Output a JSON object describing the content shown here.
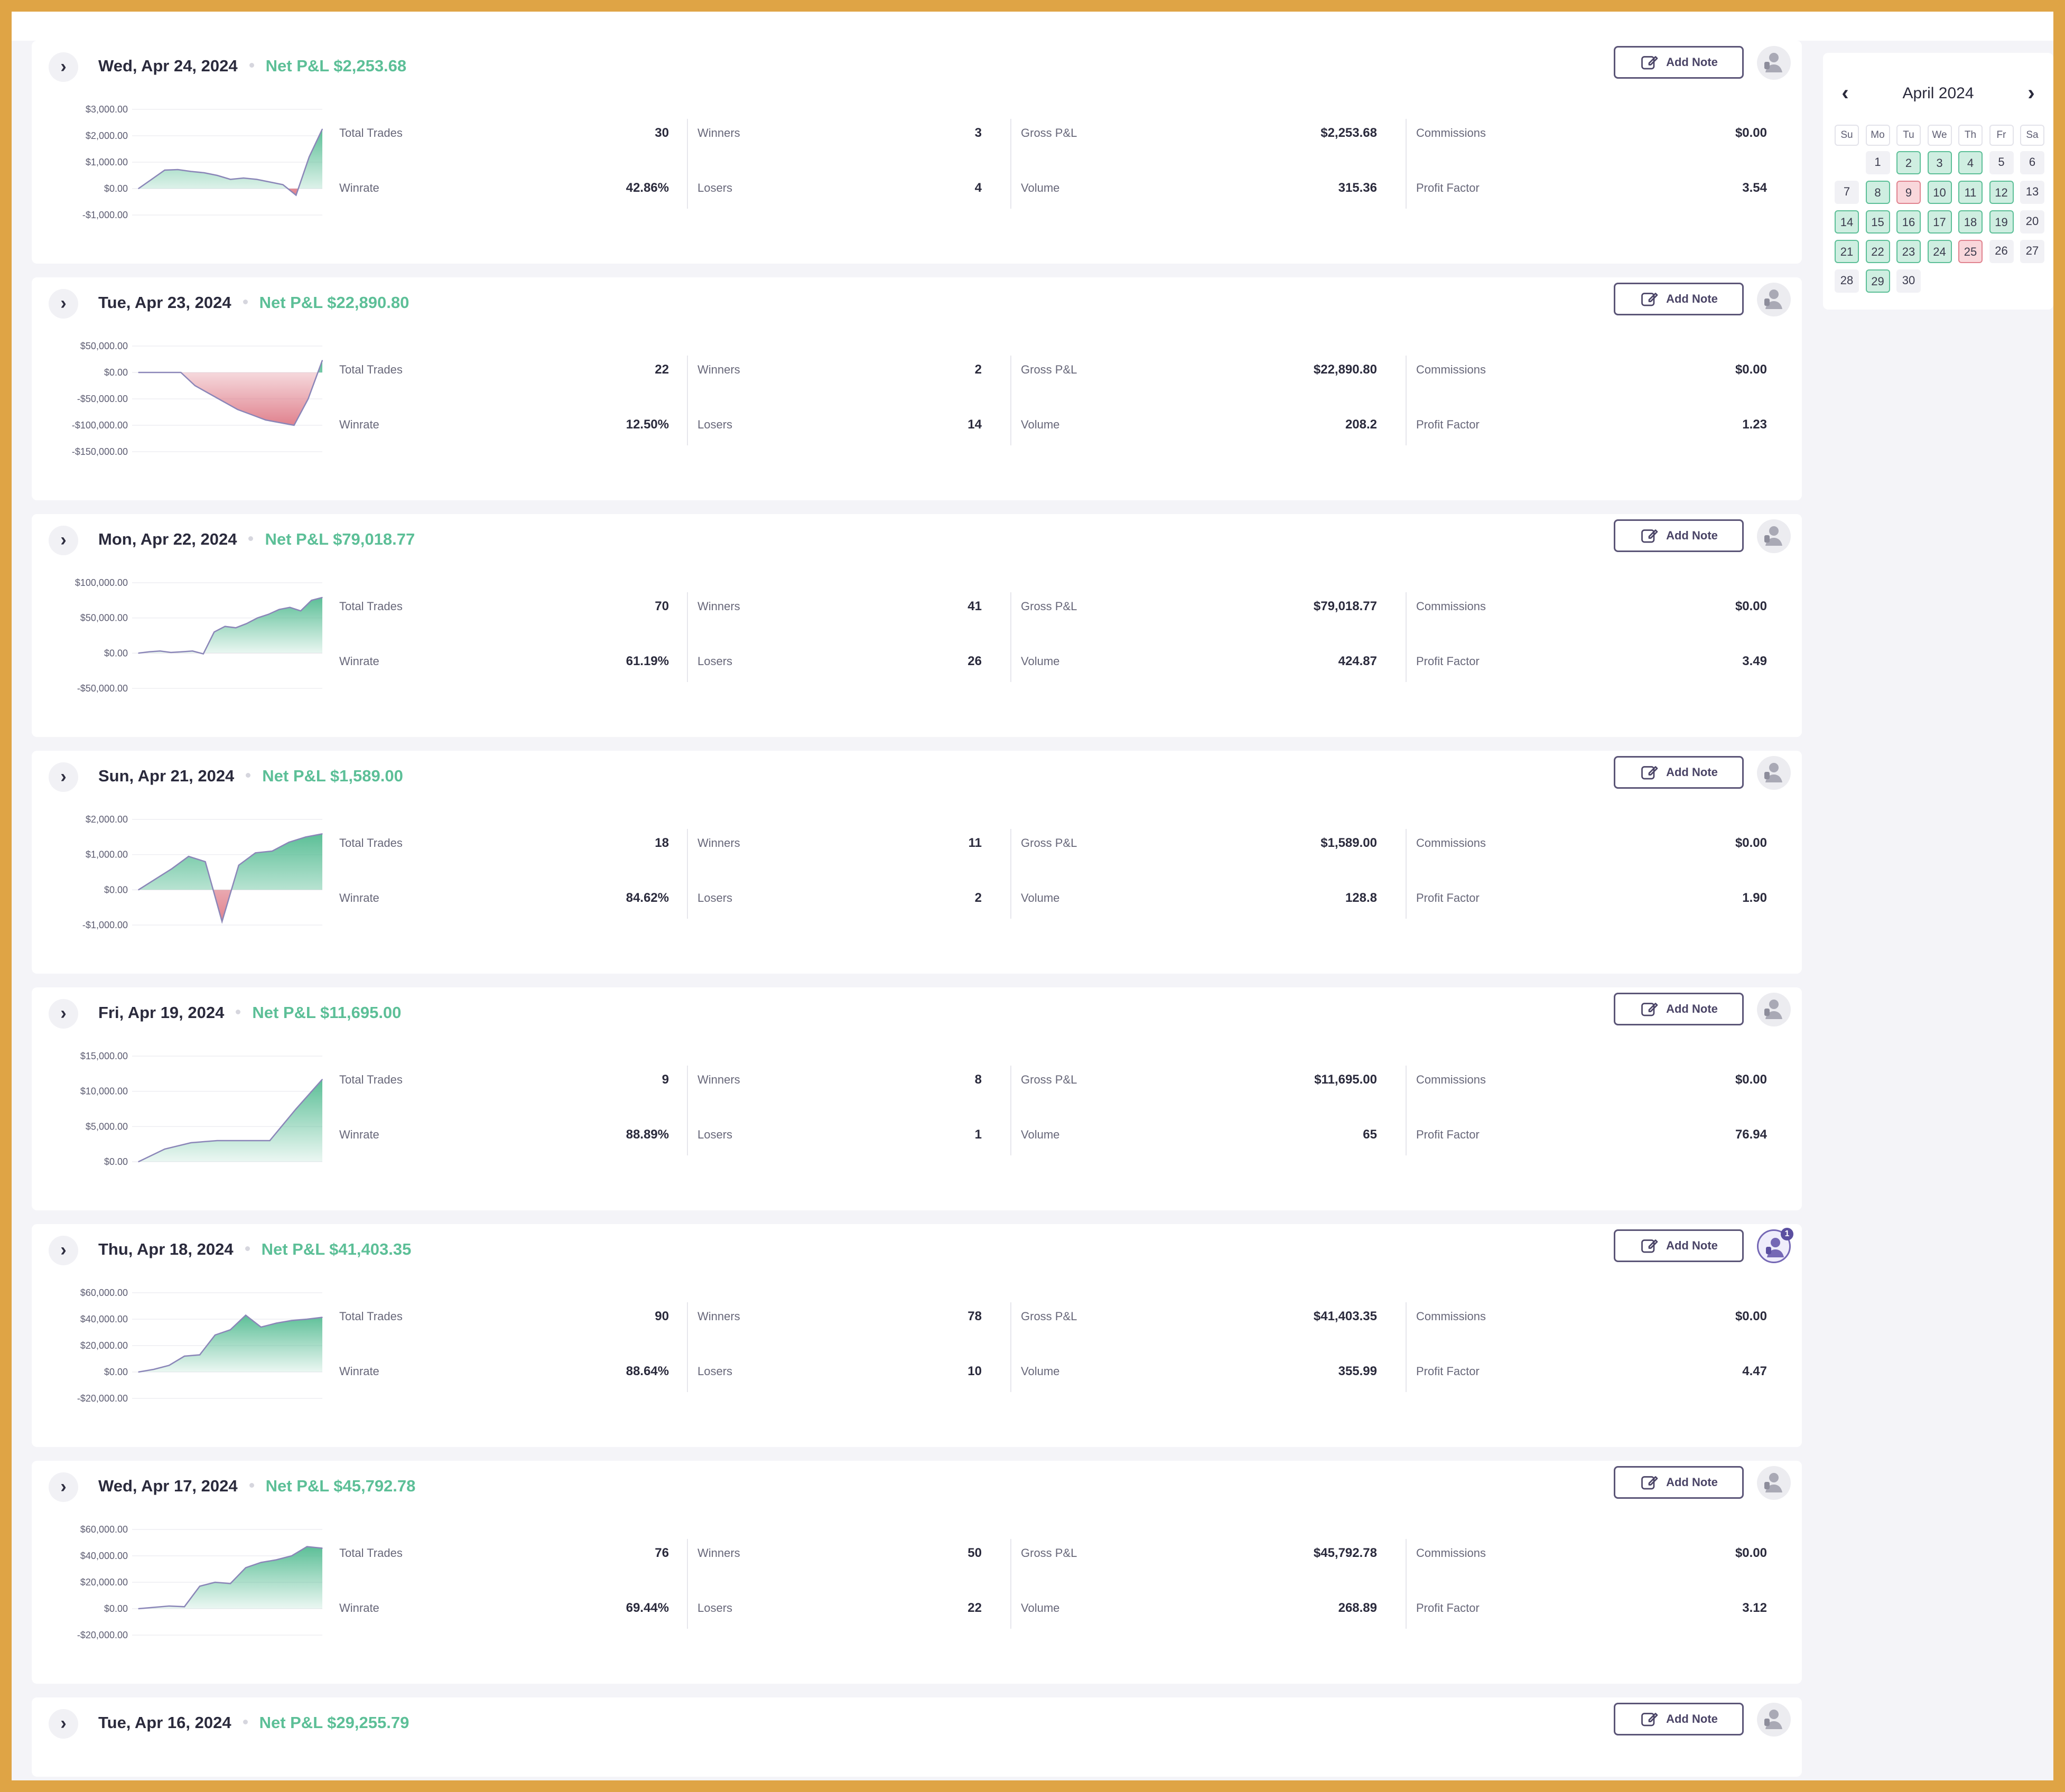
{
  "add_note_label": "Add Note",
  "net_pnl_prefix": "Net P&L",
  "stat_labels": {
    "total_trades": "Total Trades",
    "winrate": "Winrate",
    "winners": "Winners",
    "losers": "Losers",
    "gross_pnl": "Gross P&L",
    "volume": "Volume",
    "commissions": "Commissions",
    "profit_factor": "Profit Factor"
  },
  "colors": {
    "profit_green": "#5cbf97",
    "loss_red": "#e0828e",
    "accent_purple": "#5b5577",
    "frame_gold": "#dfa445"
  },
  "days": [
    {
      "date": "Wed, Apr 24, 2024",
      "net_pnl": "$2,253.68",
      "stats": {
        "total_trades": "30",
        "winrate": "42.86%",
        "winners": "3",
        "losers": "4",
        "gross_pnl": "$2,253.68",
        "volume": "315.36",
        "commissions": "$0.00",
        "profit_factor": "3.54"
      },
      "has_notes": false,
      "note_count": "",
      "chart_data": {
        "type": "area",
        "y_ticks": [
          "$3,000.00",
          "$2,000.00",
          "$1,000.00",
          "$0.00",
          "-$1,000.00"
        ],
        "ylim": [
          -1000,
          3000
        ],
        "y": [
          0,
          350,
          700,
          720,
          650,
          600,
          500,
          350,
          400,
          350,
          250,
          150,
          -250,
          1200,
          2254
        ]
      }
    },
    {
      "date": "Tue, Apr 23, 2024",
      "net_pnl": "$22,890.80",
      "stats": {
        "total_trades": "22",
        "winrate": "12.50%",
        "winners": "2",
        "losers": "14",
        "gross_pnl": "$22,890.80",
        "volume": "208.2",
        "commissions": "$0.00",
        "profit_factor": "1.23"
      },
      "has_notes": false,
      "note_count": "",
      "chart_data": {
        "type": "area",
        "y_ticks": [
          "$50,000.00",
          "$0.00",
          "-$50,000.00",
          "-$100,000.00",
          "-$150,000.00"
        ],
        "ylim": [
          -150000,
          50000
        ],
        "y": [
          0,
          0,
          0,
          0,
          -25000,
          -40000,
          -55000,
          -70000,
          -80000,
          -90000,
          -95000,
          -100000,
          -50000,
          22891
        ]
      }
    },
    {
      "date": "Mon, Apr 22, 2024",
      "net_pnl": "$79,018.77",
      "stats": {
        "total_trades": "70",
        "winrate": "61.19%",
        "winners": "41",
        "losers": "26",
        "gross_pnl": "$79,018.77",
        "volume": "424.87",
        "commissions": "$0.00",
        "profit_factor": "3.49"
      },
      "has_notes": false,
      "note_count": "",
      "chart_data": {
        "type": "area",
        "y_ticks": [
          "$100,000.00",
          "$50,000.00",
          "$0.00",
          "-$50,000.00"
        ],
        "ylim": [
          -50000,
          100000
        ],
        "y": [
          0,
          2000,
          3000,
          1000,
          2000,
          3000,
          -1000,
          30000,
          38000,
          36000,
          42000,
          50000,
          55000,
          62000,
          65000,
          60000,
          75000,
          79019
        ]
      }
    },
    {
      "date": "Sun, Apr 21, 2024",
      "net_pnl": "$1,589.00",
      "stats": {
        "total_trades": "18",
        "winrate": "84.62%",
        "winners": "11",
        "losers": "2",
        "gross_pnl": "$1,589.00",
        "volume": "128.8",
        "commissions": "$0.00",
        "profit_factor": "1.90"
      },
      "has_notes": false,
      "note_count": "",
      "chart_data": {
        "type": "area",
        "y_ticks": [
          "$2,000.00",
          "$1,000.00",
          "$0.00",
          "-$1,000.00"
        ],
        "ylim": [
          -1000,
          2000
        ],
        "y": [
          0,
          300,
          600,
          950,
          800,
          -900,
          700,
          1050,
          1100,
          1350,
          1500,
          1589
        ]
      }
    },
    {
      "date": "Fri, Apr 19, 2024",
      "net_pnl": "$11,695.00",
      "stats": {
        "total_trades": "9",
        "winrate": "88.89%",
        "winners": "8",
        "losers": "1",
        "gross_pnl": "$11,695.00",
        "volume": "65",
        "commissions": "$0.00",
        "profit_factor": "76.94"
      },
      "has_notes": false,
      "note_count": "",
      "chart_data": {
        "type": "area",
        "y_ticks": [
          "$15,000.00",
          "$10,000.00",
          "$5,000.00",
          "$0.00"
        ],
        "ylim": [
          0,
          15000
        ],
        "y": [
          0,
          1800,
          2700,
          3000,
          3000,
          3000,
          7500,
          11695
        ]
      }
    },
    {
      "date": "Thu, Apr 18, 2024",
      "net_pnl": "$41,403.35",
      "stats": {
        "total_trades": "90",
        "winrate": "88.64%",
        "winners": "78",
        "losers": "10",
        "gross_pnl": "$41,403.35",
        "volume": "355.99",
        "commissions": "$0.00",
        "profit_factor": "4.47"
      },
      "has_notes": true,
      "note_count": "1",
      "chart_data": {
        "type": "area",
        "y_ticks": [
          "$60,000.00",
          "$40,000.00",
          "$20,000.00",
          "$0.00",
          "-$20,000.00"
        ],
        "ylim": [
          -20000,
          60000
        ],
        "y": [
          0,
          2000,
          5000,
          12000,
          13000,
          28000,
          32000,
          43000,
          34000,
          37000,
          39000,
          40000,
          41403
        ]
      }
    },
    {
      "date": "Wed, Apr 17, 2024",
      "net_pnl": "$45,792.78",
      "stats": {
        "total_trades": "76",
        "winrate": "69.44%",
        "winners": "50",
        "losers": "22",
        "gross_pnl": "$45,792.78",
        "volume": "268.89",
        "commissions": "$0.00",
        "profit_factor": "3.12"
      },
      "has_notes": false,
      "note_count": "",
      "chart_data": {
        "type": "area",
        "y_ticks": [
          "$60,000.00",
          "$40,000.00",
          "$20,000.00",
          "$0.00",
          "-$20,000.00"
        ],
        "ylim": [
          -20000,
          60000
        ],
        "y": [
          0,
          1000,
          2000,
          1500,
          17000,
          20000,
          19000,
          31000,
          35000,
          37000,
          40000,
          47000,
          45793
        ]
      }
    },
    {
      "date": "Tue, Apr 16, 2024",
      "net_pnl": "$29,255.79",
      "has_notes": false,
      "note_count": ""
    }
  ],
  "calendar": {
    "title": "April 2024",
    "weekdays": [
      "Su",
      "Mo",
      "Tu",
      "We",
      "Th",
      "Fr",
      "Sa"
    ],
    "start_weekday": 1,
    "days": [
      {
        "d": "1",
        "s": "none"
      },
      {
        "d": "2",
        "s": "win"
      },
      {
        "d": "3",
        "s": "win"
      },
      {
        "d": "4",
        "s": "win"
      },
      {
        "d": "5",
        "s": "none"
      },
      {
        "d": "6",
        "s": "none"
      },
      {
        "d": "7",
        "s": "none"
      },
      {
        "d": "8",
        "s": "win"
      },
      {
        "d": "9",
        "s": "loss"
      },
      {
        "d": "10",
        "s": "win"
      },
      {
        "d": "11",
        "s": "win"
      },
      {
        "d": "12",
        "s": "win"
      },
      {
        "d": "13",
        "s": "none"
      },
      {
        "d": "14",
        "s": "win"
      },
      {
        "d": "15",
        "s": "win"
      },
      {
        "d": "16",
        "s": "win"
      },
      {
        "d": "17",
        "s": "win"
      },
      {
        "d": "18",
        "s": "win"
      },
      {
        "d": "19",
        "s": "win"
      },
      {
        "d": "20",
        "s": "none"
      },
      {
        "d": "21",
        "s": "win"
      },
      {
        "d": "22",
        "s": "win"
      },
      {
        "d": "23",
        "s": "win"
      },
      {
        "d": "24",
        "s": "win"
      },
      {
        "d": "25",
        "s": "loss"
      },
      {
        "d": "26",
        "s": "none"
      },
      {
        "d": "27",
        "s": "none"
      },
      {
        "d": "28",
        "s": "none"
      },
      {
        "d": "29",
        "s": "win"
      },
      {
        "d": "30",
        "s": "none"
      }
    ]
  }
}
